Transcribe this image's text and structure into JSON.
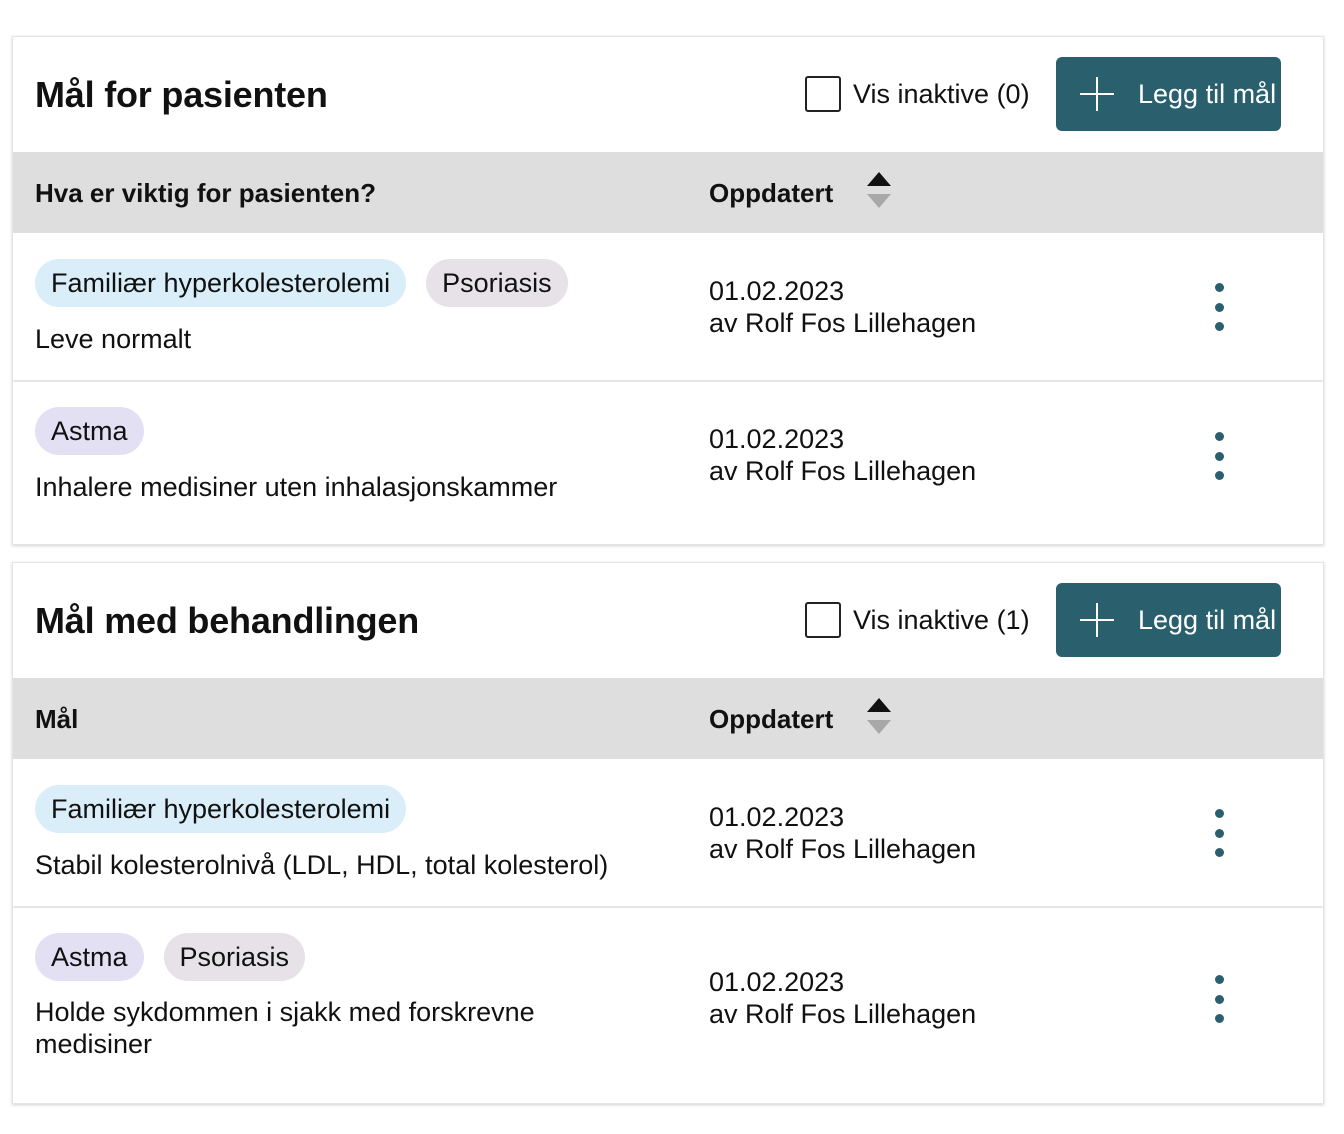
{
  "colors": {
    "accent": "#2a5f6d",
    "tag_blue": "#d9eef8",
    "tag_lilac": "#e3e0f4",
    "tag_gray": "#e6e2e8",
    "header_band": "#dedede"
  },
  "icons": {
    "add": "plus-icon",
    "sort": "sort-icon",
    "menu": "kebab-menu-icon"
  },
  "patient_goals": {
    "title": "Mål for pasienten",
    "inactive_label": "Vis inaktive (0)",
    "add_label": "Legg til mål",
    "col_goal": "Hva er viktig for pasienten?",
    "col_updated": "Oppdatert",
    "rows": [
      {
        "tags": [
          "Familiær hyperkolesterolemi",
          "Psoriasis"
        ],
        "text": "Leve normalt",
        "date": "01.02.2023",
        "by": "av Rolf Fos Lillehagen"
      },
      {
        "tags": [
          "Astma"
        ],
        "text": "Inhalere medisiner uten inhalasjonskammer",
        "date": "01.02.2023",
        "by": "av Rolf Fos Lillehagen"
      }
    ]
  },
  "treatment_goals": {
    "title": "Mål med behandlingen",
    "inactive_label": "Vis inaktive (1)",
    "add_label": "Legg til mål",
    "col_goal": "Mål",
    "col_updated": "Oppdatert",
    "rows": [
      {
        "tags": [
          "Familiær hyperkolesterolemi"
        ],
        "text": "Stabil kolesterolnivå (LDL, HDL, total kolesterol)",
        "date": "01.02.2023",
        "by": "av Rolf Fos Lillehagen"
      },
      {
        "tags": [
          "Astma",
          "Psoriasis"
        ],
        "text": "Holde sykdommen i sjakk med forskrevne medisiner",
        "date": "01.02.2023",
        "by": "av Rolf Fos Lillehagen"
      }
    ]
  }
}
